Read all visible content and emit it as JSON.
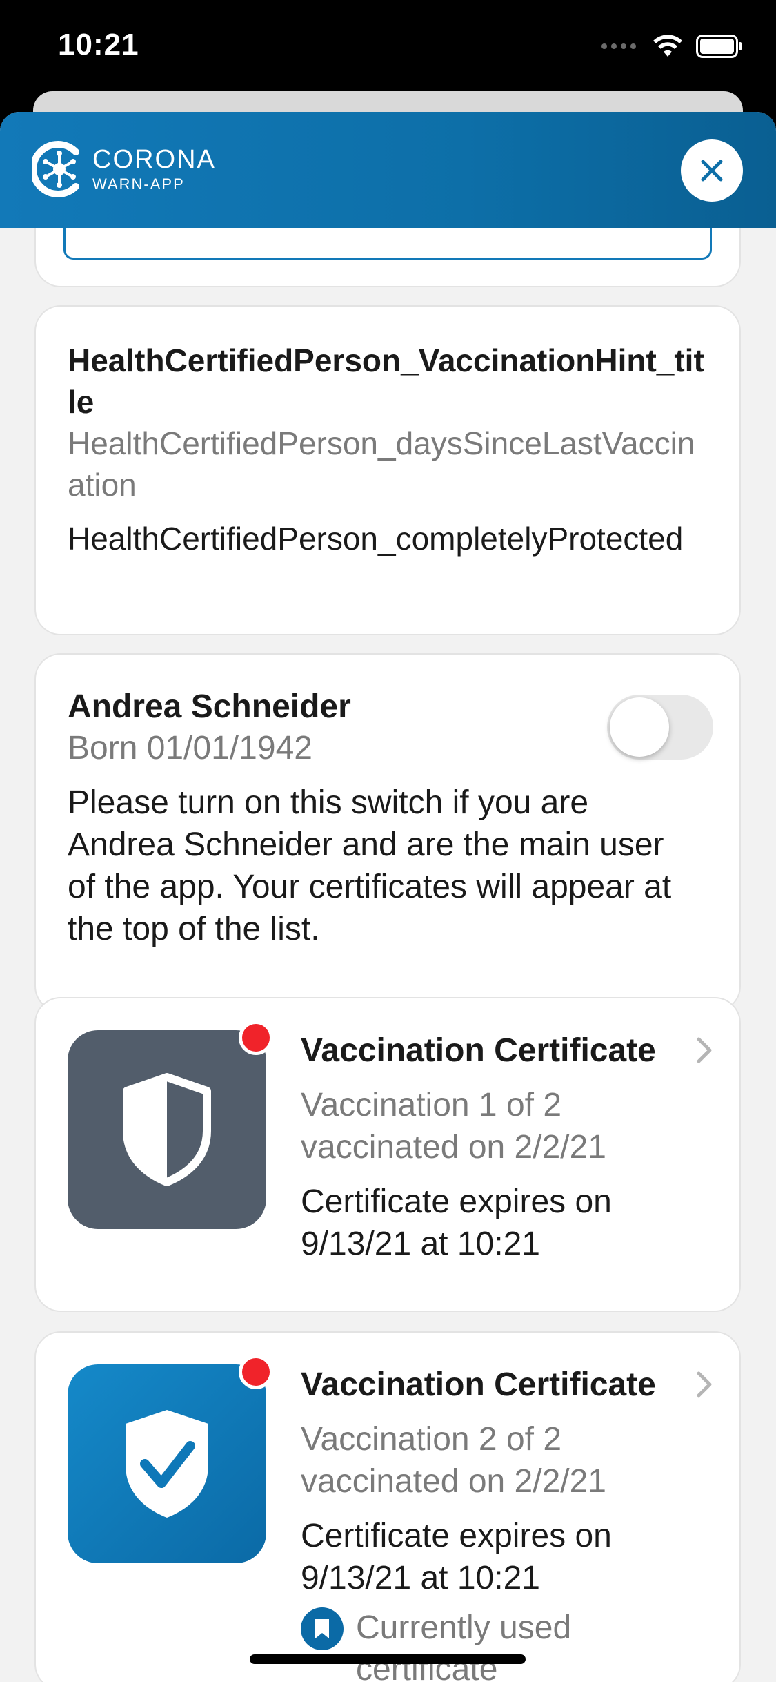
{
  "status_bar": {
    "time": "10:21",
    "icons": [
      "signal-dots-icon",
      "wifi-icon",
      "battery-icon"
    ]
  },
  "header": {
    "logo_title": "CORONA",
    "logo_subtitle": "WARN-APP",
    "close_icon": "close-icon"
  },
  "colors": {
    "brand_blue": "#1279b8",
    "grey_icon_bg": "#525d6b",
    "notification_red": "#f0232a",
    "secondary_text": "#7a7a7a"
  },
  "vaccination_hint": {
    "title": "HealthCertifiedPerson_VaccinationHint_title",
    "subtitle": "HealthCertifiedPerson_daysSinceLastVaccination",
    "body": "HealthCertifiedPerson_completelyProtected"
  },
  "person": {
    "name": "Andrea Schneider",
    "born": "Born 01/01/1942",
    "description": "Please turn on this switch if you are Andrea Schneider and are the main user of the app. Your certificates will appear at the top of the list.",
    "main_user_switch": false
  },
  "certificates": [
    {
      "title": "Vaccination Certificate",
      "dose": "Vaccination 1 of 2",
      "date": "vaccinated on 2/2/21",
      "expiry": "Certificate expires on 9/13/21 at 10:21",
      "icon": "half-shield-icon",
      "has_notification": true
    },
    {
      "title": "Vaccination Certificate",
      "dose": "Vaccination 2 of 2",
      "date": "vaccinated on 2/2/21",
      "expiry": "Certificate expires on 9/13/21 at 10:21",
      "icon": "check-shield-icon",
      "has_notification": true,
      "current_label": "Currently used certificate"
    }
  ]
}
